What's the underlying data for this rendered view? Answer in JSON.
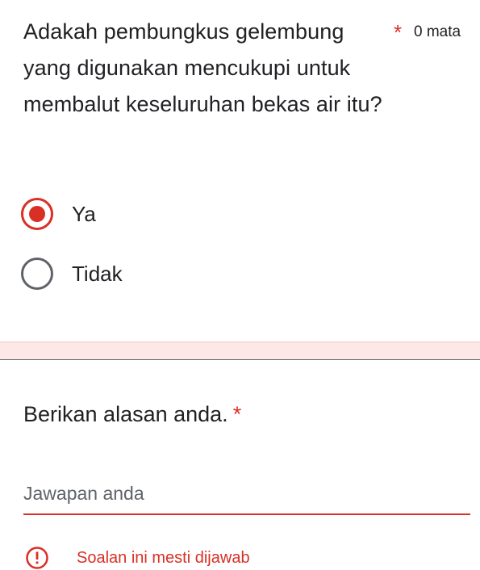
{
  "question1": {
    "title": "Adakah pembungkus gelembung yang digunakan mencukupi untuk membalut keseluruhan bekas air itu?",
    "required_star": "*",
    "points": "0 mata",
    "options": [
      {
        "label": "Ya",
        "selected": true
      },
      {
        "label": "Tidak",
        "selected": false
      }
    ]
  },
  "question2": {
    "title": "Berikan alasan anda.",
    "required_star": "*",
    "answer_value": "",
    "answer_placeholder": "Jawapan anda",
    "error_message": "Soalan ini mesti dijawab"
  },
  "colors": {
    "error_red": "#d93025",
    "error_band": "#fce8e6",
    "text": "#202124",
    "muted": "#5f6368"
  },
  "icons": {
    "error": "error-exclamation-icon"
  }
}
